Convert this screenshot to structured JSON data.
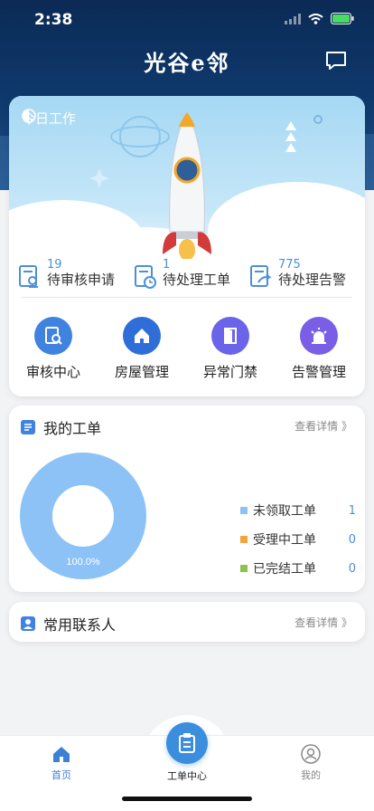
{
  "status_bar": {
    "time": "2:38"
  },
  "header": {
    "title": "光谷e邻",
    "message_icon": "message-icon"
  },
  "today_work": {
    "title": "今日工作",
    "stats": [
      {
        "count": "19",
        "label": "待审核申请",
        "icon": "review-doc-icon"
      },
      {
        "count": "1",
        "label": "待处理工单",
        "icon": "clock-doc-icon"
      },
      {
        "count": "775",
        "label": "待处理告警",
        "icon": "forward-doc-icon"
      }
    ],
    "quick_actions": [
      {
        "label": "审核中心",
        "icon": "search-doc-icon",
        "color": "#3f82e0"
      },
      {
        "label": "房屋管理",
        "icon": "house-icon",
        "color": "#2f6ed8"
      },
      {
        "label": "异常门禁",
        "icon": "door-icon",
        "color": "#6b63e8"
      },
      {
        "label": "告警管理",
        "icon": "alarm-icon",
        "color": "#7a5ee6"
      }
    ]
  },
  "my_orders": {
    "title": "我的工单",
    "more": "查看详情 》",
    "chart_data": {
      "type": "pie",
      "categories": [
        "未领取工单",
        "受理中工单",
        "已完结工单"
      ],
      "values": [
        1,
        0,
        0
      ],
      "colors": [
        "#8cc2f5",
        "#f2a53a",
        "#8cc34a"
      ],
      "center_label": "100.0%"
    },
    "legend": [
      {
        "label": "未领取工单",
        "value": "1",
        "color": "#8cc2f5"
      },
      {
        "label": "受理中工单",
        "value": "0",
        "color": "#f2a53a"
      },
      {
        "label": "已完结工单",
        "value": "0",
        "color": "#8cc34a"
      }
    ]
  },
  "contacts": {
    "title": "常用联系人",
    "more": "查看详情 》"
  },
  "tabbar": {
    "tabs": [
      {
        "label": "首页",
        "icon": "home-icon",
        "active": true
      },
      {
        "label": "工单中心",
        "icon": "clipboard-icon",
        "active": false
      },
      {
        "label": "我的",
        "icon": "user-icon",
        "active": false
      }
    ]
  }
}
